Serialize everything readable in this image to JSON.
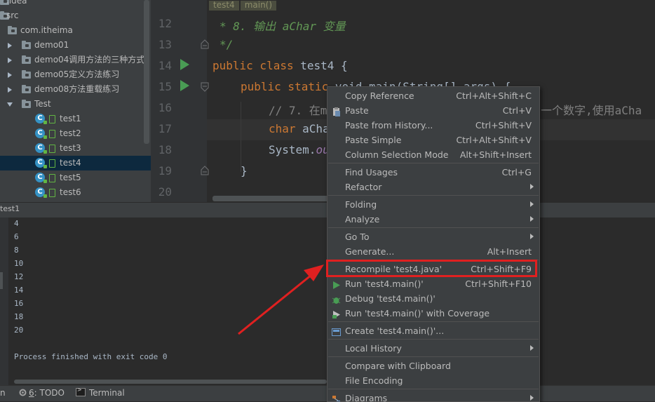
{
  "project_tree": {
    "items": [
      {
        "label": ".idea",
        "kind": "folder",
        "expand": "none"
      },
      {
        "label": "src",
        "kind": "folder",
        "expand": "none"
      },
      {
        "label": "com.itheima",
        "kind": "package",
        "expand": "none"
      },
      {
        "label": "demo01",
        "kind": "package",
        "expand": "collapsed"
      },
      {
        "label": "demo04调用方法的三种方式",
        "kind": "package",
        "expand": "collapsed"
      },
      {
        "label": "demo05定义方法练习",
        "kind": "package",
        "expand": "collapsed"
      },
      {
        "label": "demo08方法重载练习",
        "kind": "package",
        "expand": "collapsed"
      },
      {
        "label": "Test",
        "kind": "package",
        "expand": "expanded"
      },
      {
        "label": "test1",
        "kind": "class",
        "expand": "none"
      },
      {
        "label": "test2",
        "kind": "class",
        "expand": "none"
      },
      {
        "label": "test3",
        "kind": "class",
        "expand": "none"
      },
      {
        "label": "test4",
        "kind": "class",
        "expand": "none",
        "selected": true
      },
      {
        "label": "test5",
        "kind": "class",
        "expand": "none"
      },
      {
        "label": "test6",
        "kind": "class",
        "expand": "none"
      }
    ],
    "class_icon_letter": "C"
  },
  "editor": {
    "breadcrumb_tags": [
      "test4",
      "main()"
    ],
    "line_numbers": [
      "12",
      "13",
      "14",
      "15",
      "16",
      "17",
      "18",
      "19",
      "20"
    ],
    "lines": {
      "l12": "* 8. 输出 aChar 变量",
      "l13": "*/",
      "l14_kw": "public class",
      "l14_rest": " test4 {",
      "l15_kw": "public static",
      "l15_rest": " void main(String[] args) {",
      "l16_cmt": "// 7. 在m",
      "l16_tail": "一个数字,使用aCha",
      "l17_kw": "char",
      "l17_rest": " aCha",
      "l18_a": "System.",
      "l18_b": "ou",
      "l19": "}"
    }
  },
  "run_panel": {
    "title": "test1",
    "output": [
      "4",
      "6",
      "8",
      "10",
      "12",
      "14",
      "16",
      "18",
      "20",
      "",
      "Process finished with exit code 0"
    ]
  },
  "bottom_bar": {
    "left_fragment": "n",
    "todo_number": "6",
    "todo_label": ": TODO",
    "terminal_label": "Terminal"
  },
  "context_menu": {
    "items": [
      {
        "label": "Copy Reference",
        "shortcut": "Ctrl+Alt+Shift+C",
        "icon": "none"
      },
      {
        "label": "Paste",
        "shortcut": "Ctrl+V",
        "icon": "paste-icon"
      },
      {
        "label": "Paste from History...",
        "shortcut": "Ctrl+Shift+V",
        "icon": "none"
      },
      {
        "label": "Paste Simple",
        "shortcut": "Ctrl+Alt+Shift+V",
        "icon": "none"
      },
      {
        "label": "Column Selection Mode",
        "shortcut": "Alt+Shift+Insert",
        "icon": "none"
      },
      {
        "sep": true
      },
      {
        "label": "Find Usages",
        "shortcut": "Ctrl+G",
        "icon": "none"
      },
      {
        "label": "Refactor",
        "submenu": true,
        "icon": "none"
      },
      {
        "sep": true
      },
      {
        "label": "Folding",
        "submenu": true,
        "icon": "none"
      },
      {
        "label": "Analyze",
        "submenu": true,
        "icon": "none"
      },
      {
        "sep": true
      },
      {
        "label": "Go To",
        "submenu": true,
        "icon": "none"
      },
      {
        "label": "Generate...",
        "shortcut": "Alt+Insert",
        "icon": "none"
      },
      {
        "sep": true
      },
      {
        "label": "Recompile 'test4.java'",
        "shortcut": "Ctrl+Shift+F9",
        "icon": "none",
        "highlighted": true
      },
      {
        "label": "Run 'test4.main()'",
        "shortcut": "Ctrl+Shift+F10",
        "icon": "run-icon"
      },
      {
        "label": "Debug 'test4.main()'",
        "icon": "debug-icon"
      },
      {
        "label": "Run 'test4.main()' with Coverage",
        "icon": "coverage-icon"
      },
      {
        "sep": true
      },
      {
        "label": "Create 'test4.main()'...",
        "icon": "create-config-icon"
      },
      {
        "sep": true
      },
      {
        "label": "Local History",
        "submenu": true,
        "icon": "none"
      },
      {
        "sep": true
      },
      {
        "label": "Compare with Clipboard",
        "icon": "none"
      },
      {
        "label": "File Encoding",
        "icon": "none"
      },
      {
        "sep": true
      },
      {
        "label": "Diagrams",
        "submenu": true,
        "icon": "diagrams-icon"
      }
    ]
  },
  "colors": {
    "highlight_box": "#e02020",
    "arrow": "#e02020"
  }
}
